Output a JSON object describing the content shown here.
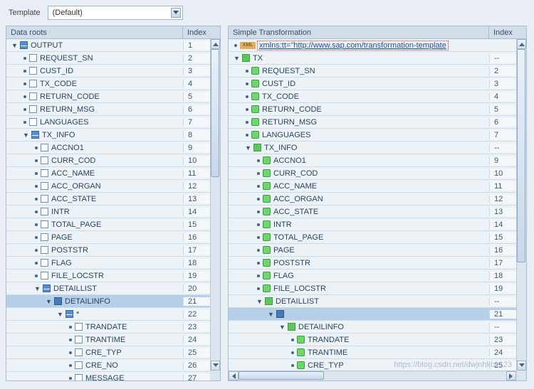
{
  "toolbar": {
    "template_label": "Template",
    "dropdown_value": "(Default)"
  },
  "left": {
    "header": {
      "name": "Data roots",
      "index": "Index"
    },
    "rows": [
      {
        "indent": 0,
        "toggle": "▼",
        "ico": "tbl",
        "txt": "OUTPUT",
        "idx": "1"
      },
      {
        "indent": 1,
        "bullet": true,
        "ico": "box",
        "txt": "REQUEST_SN",
        "idx": "2"
      },
      {
        "indent": 1,
        "bullet": true,
        "ico": "box",
        "txt": "CUST_ID",
        "idx": "3"
      },
      {
        "indent": 1,
        "bullet": true,
        "ico": "box",
        "txt": "TX_CODE",
        "idx": "4"
      },
      {
        "indent": 1,
        "bullet": true,
        "ico": "box",
        "txt": "RETURN_CODE",
        "idx": "5"
      },
      {
        "indent": 1,
        "bullet": true,
        "ico": "box",
        "txt": "RETURN_MSG",
        "idx": "6"
      },
      {
        "indent": 1,
        "bullet": true,
        "ico": "box",
        "txt": "LANGUAGES",
        "idx": "7"
      },
      {
        "indent": 1,
        "toggle": "▼",
        "ico": "tbl",
        "txt": "TX_INFO",
        "idx": "8"
      },
      {
        "indent": 2,
        "bullet": true,
        "ico": "box",
        "txt": "ACCNO1",
        "idx": "9"
      },
      {
        "indent": 2,
        "bullet": true,
        "ico": "box",
        "txt": "CURR_COD",
        "idx": "10"
      },
      {
        "indent": 2,
        "bullet": true,
        "ico": "box",
        "txt": "ACC_NAME",
        "idx": "11"
      },
      {
        "indent": 2,
        "bullet": true,
        "ico": "box",
        "txt": "ACC_ORGAN",
        "idx": "12"
      },
      {
        "indent": 2,
        "bullet": true,
        "ico": "box",
        "txt": "ACC_STATE",
        "idx": "13"
      },
      {
        "indent": 2,
        "bullet": true,
        "ico": "box",
        "txt": "INTR",
        "idx": "14"
      },
      {
        "indent": 2,
        "bullet": true,
        "ico": "box",
        "txt": "TOTAL_PAGE",
        "idx": "15"
      },
      {
        "indent": 2,
        "bullet": true,
        "ico": "box",
        "txt": "PAGE",
        "idx": "16"
      },
      {
        "indent": 2,
        "bullet": true,
        "ico": "box",
        "txt": "POSTSTR",
        "idx": "17"
      },
      {
        "indent": 2,
        "bullet": true,
        "ico": "box",
        "txt": "FLAG",
        "idx": "18"
      },
      {
        "indent": 2,
        "bullet": true,
        "ico": "box",
        "txt": "FILE_LOCSTR",
        "idx": "19"
      },
      {
        "indent": 2,
        "toggle": "▼",
        "ico": "tbl",
        "txt": "DETAILLIST",
        "idx": "20"
      },
      {
        "indent": 3,
        "toggle": "▼",
        "ico": "grd",
        "txt": "DETAILINFO",
        "idx": "21",
        "sel": true
      },
      {
        "indent": 4,
        "toggle": "▼",
        "ico": "tbl",
        "txt": "*",
        "idx": "22"
      },
      {
        "indent": 5,
        "bullet": true,
        "ico": "box",
        "txt": "TRANDATE",
        "idx": "23"
      },
      {
        "indent": 5,
        "bullet": true,
        "ico": "box",
        "txt": "TRANTIME",
        "idx": "24"
      },
      {
        "indent": 5,
        "bullet": true,
        "ico": "box",
        "txt": "CRE_TYP",
        "idx": "25"
      },
      {
        "indent": 5,
        "bullet": true,
        "ico": "box",
        "txt": "CRE_NO",
        "idx": "26"
      },
      {
        "indent": 5,
        "bullet": true,
        "ico": "box",
        "txt": "MESSAGE",
        "idx": "27"
      }
    ]
  },
  "right": {
    "header": {
      "name": "Simple Transformation",
      "index": "Index"
    },
    "xml_label": "XML",
    "xml_text": "xmlns:tt=\"http://www.sap.com/transformation-template",
    "rows": [
      {
        "indent": 0,
        "toggle": "▼",
        "ico": "grn-sq",
        "txt": "TX",
        "idx": "--"
      },
      {
        "indent": 1,
        "bullet": true,
        "ico": "grn",
        "txt": "REQUEST_SN",
        "idx": "2"
      },
      {
        "indent": 1,
        "bullet": true,
        "ico": "grn",
        "txt": "CUST_ID",
        "idx": "3"
      },
      {
        "indent": 1,
        "bullet": true,
        "ico": "grn",
        "txt": "TX_CODE",
        "idx": "4"
      },
      {
        "indent": 1,
        "bullet": true,
        "ico": "grn",
        "txt": "RETURN_CODE",
        "idx": "5"
      },
      {
        "indent": 1,
        "bullet": true,
        "ico": "grn",
        "txt": "RETURN_MSG",
        "idx": "6"
      },
      {
        "indent": 1,
        "bullet": true,
        "ico": "grn",
        "txt": "LANGUAGES",
        "idx": "7"
      },
      {
        "indent": 1,
        "toggle": "▼",
        "ico": "grn-sq",
        "txt": "TX_INFO",
        "idx": "--"
      },
      {
        "indent": 2,
        "bullet": true,
        "ico": "grn",
        "txt": "ACCNO1",
        "idx": "9"
      },
      {
        "indent": 2,
        "bullet": true,
        "ico": "grn",
        "txt": "CURR_COD",
        "idx": "10"
      },
      {
        "indent": 2,
        "bullet": true,
        "ico": "grn",
        "txt": "ACC_NAME",
        "idx": "11"
      },
      {
        "indent": 2,
        "bullet": true,
        "ico": "grn",
        "txt": "ACC_ORGAN",
        "idx": "12"
      },
      {
        "indent": 2,
        "bullet": true,
        "ico": "grn",
        "txt": "ACC_STATE",
        "idx": "13"
      },
      {
        "indent": 2,
        "bullet": true,
        "ico": "grn",
        "txt": "INTR",
        "idx": "14"
      },
      {
        "indent": 2,
        "bullet": true,
        "ico": "grn",
        "txt": "TOTAL_PAGE",
        "idx": "15"
      },
      {
        "indent": 2,
        "bullet": true,
        "ico": "grn",
        "txt": "PAGE",
        "idx": "16"
      },
      {
        "indent": 2,
        "bullet": true,
        "ico": "grn",
        "txt": "POSTSTR",
        "idx": "17"
      },
      {
        "indent": 2,
        "bullet": true,
        "ico": "grn",
        "txt": "FLAG",
        "idx": "18"
      },
      {
        "indent": 2,
        "bullet": true,
        "ico": "grn",
        "txt": "FILE_LOCSTR",
        "idx": "19"
      },
      {
        "indent": 2,
        "toggle": "▼",
        "ico": "grn-sq",
        "txt": "DETAILLIST",
        "idx": "--"
      },
      {
        "indent": 3,
        "toggle": "▼",
        "ico": "grd",
        "txt": "",
        "idx": "21",
        "sel": true
      },
      {
        "indent": 4,
        "toggle": "▼",
        "ico": "grn-sq",
        "txt": "DETAILINFO",
        "idx": "--"
      },
      {
        "indent": 5,
        "bullet": true,
        "ico": "grn",
        "txt": "TRANDATE",
        "idx": "23"
      },
      {
        "indent": 5,
        "bullet": true,
        "ico": "grn",
        "txt": "TRANTIME",
        "idx": "24"
      },
      {
        "indent": 5,
        "bullet": true,
        "ico": "grn",
        "txt": "CRE_TYP",
        "idx": "25"
      }
    ]
  },
  "watermark": "https://blog.csdn.net/dwjnhkbc123"
}
